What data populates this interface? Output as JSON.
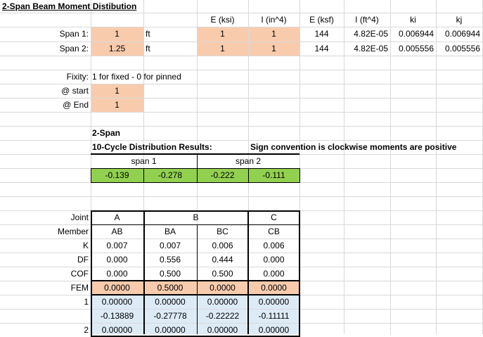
{
  "title": "2-Span Beam Moment Distibution",
  "colors": {
    "peach": "#f8cbad",
    "green": "#92d050",
    "blue": "#ddebf7",
    "grid": "#d9d9d9"
  },
  "props_headers": [
    "E (ksi)",
    "I (in^4)",
    "E (ksf)",
    "I (ft^4)",
    "ki",
    "kj"
  ],
  "spans": [
    {
      "label": "Span 1:",
      "length": "1",
      "unit": "ft",
      "E_ksi": "1",
      "I_in4": "1",
      "E_ksf": "144",
      "I_ft4": "4.82E-05",
      "ki": "0.006944",
      "kj": "0.006944"
    },
    {
      "label": "Span 2:",
      "length": "1.25",
      "unit": "ft",
      "E_ksi": "1",
      "I_in4": "1",
      "E_ksf": "144",
      "I_ft4": "4.82E-05",
      "ki": "0.005556",
      "kj": "0.005556"
    }
  ],
  "fixity": {
    "label": "Fixity:",
    "note": "1 for fixed - 0 for pinned",
    "start_label": "@ start",
    "start_value": "1",
    "end_label": "@ End",
    "end_value": "1"
  },
  "results": {
    "heading": "2-Span",
    "subheading": "10-Cycle Distribution Results:",
    "sign_note": "Sign convention is clockwise moments are positive",
    "span1_label": "span 1",
    "span2_label": "span 2",
    "values": [
      "-0.139",
      "-0.278",
      "-0.222",
      "-0.111"
    ]
  },
  "table": {
    "joint_label": "Joint",
    "member_label": "Member",
    "k_label": "K",
    "df_label": "DF",
    "cof_label": "COF",
    "fem_label": "FEM",
    "joints": [
      "A",
      "B",
      "C"
    ],
    "members": [
      "AB",
      "BA",
      "BC",
      "CB"
    ],
    "K": [
      "0.007",
      "0.007",
      "0.006",
      "0.006"
    ],
    "DF": [
      "0.000",
      "0.556",
      "0.444",
      "0.000"
    ],
    "COF": [
      "0.000",
      "0.500",
      "0.500",
      "0.000"
    ],
    "FEM": [
      "0.0000",
      "0.5000",
      "0.0000",
      "0.0000"
    ],
    "cycles": [
      {
        "n": "1",
        "rows": [
          [
            "0.00000",
            "0.00000",
            "0.00000",
            "0.00000"
          ],
          [
            "-0.13889",
            "-0.27778",
            "-0.22222",
            "-0.11111"
          ]
        ]
      },
      {
        "n": "2",
        "rows": [
          [
            "0.00000",
            "0.00000",
            "0.00000",
            "0.00000"
          ]
        ]
      }
    ]
  }
}
